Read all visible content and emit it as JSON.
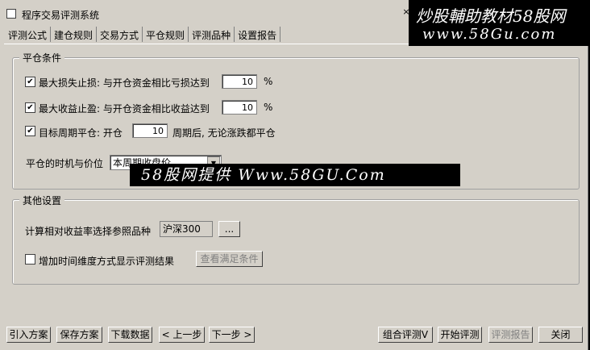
{
  "window": {
    "title": "程序交易评测系统",
    "close_glyph": "×"
  },
  "tabs": [
    "评测公式",
    "建仓规则",
    "交易方式",
    "平仓规则",
    "评测品种",
    "设置报告"
  ],
  "close_group": {
    "legend": "平仓条件",
    "max_loss": {
      "checked": true,
      "label": "最大损失止损: 与开仓资金相比亏损达到",
      "value": "10",
      "unit": "%"
    },
    "max_profit": {
      "checked": true,
      "label": "最大收益止盈: 与开仓资金相比收益达到",
      "value": "10",
      "unit": "%"
    },
    "target_period": {
      "checked": true,
      "label": "目标周期平仓: 开仓",
      "value": "10",
      "suffix": "周期后, 无论涨跌都平仓"
    },
    "timing": {
      "label": "平仓的时机与价位",
      "selected": "本周期收盘价"
    }
  },
  "other_group": {
    "legend": "其他设置",
    "reference": {
      "label": "计算相对收益率选择参照品种",
      "value": "沪深300",
      "browse": "..."
    },
    "time_dim": {
      "checked": false,
      "label": "增加时间维度方式显示评测结果",
      "button": "查看满足条件"
    }
  },
  "footer": {
    "import": "引入方案",
    "save": "保存方案",
    "download": "下载数据",
    "prev": "< 上一步",
    "next": "下一步 >",
    "combo": "组合评测V",
    "start": "开始评测",
    "report": "评测报告",
    "close": "关闭"
  },
  "watermark": {
    "top_line1": "炒股輔助教材58股网",
    "top_line2": "www.58Gu.com",
    "center": "58股网提供 Www.58GU.Com"
  }
}
